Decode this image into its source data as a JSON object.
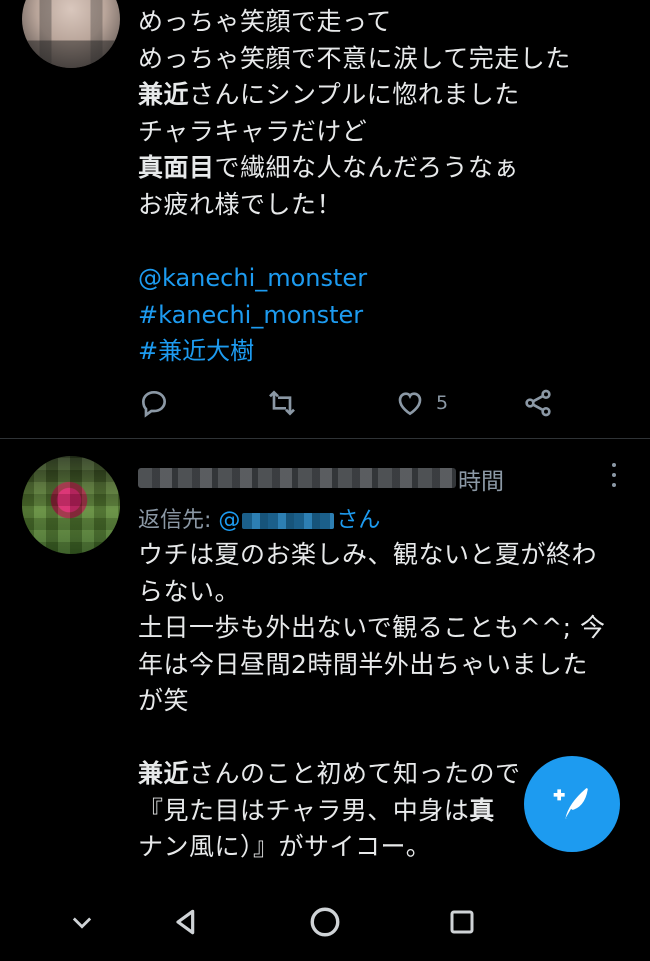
{
  "tweet1": {
    "lines": [
      {
        "text": "めっちゃ笑顔で走って"
      },
      {
        "text": "めっちゃ笑顔で不意に涙して完走した"
      },
      {
        "bold": "兼近",
        "text": "さんにシンプルに惚れました"
      },
      {
        "text": "チャラキャラだけど"
      },
      {
        "bold": "真面目",
        "text": "で繊細な人なんだろうなぁ"
      },
      {
        "text": "お疲れ様でした！"
      }
    ],
    "links": [
      "@kanechi_monster",
      "#kanechi_monster",
      "#兼近大樹"
    ],
    "actions": {
      "reply_icon": "reply-icon",
      "retweet_icon": "retweet-icon",
      "like_icon": "heart-icon",
      "like_count": "5",
      "share_icon": "share-icon"
    }
  },
  "tweet2": {
    "time_suffix": "時間",
    "reply_prefix": "返信先: ",
    "reply_handle_start": "@",
    "reply_suffix": "さん",
    "lines": [
      {
        "text": "ウチは夏のお楽しみ、観ないと夏が終わ"
      },
      {
        "text": "らない。"
      },
      {
        "text": "土日一歩も外出ないで観ることも^^; 今"
      },
      {
        "text": "年は今日昼間2時間半外出ちゃいました"
      },
      {
        "text": "が笑"
      }
    ],
    "lines_after_gap": [
      {
        "bold": "兼近",
        "text": "さんのこと初めて知ったので"
      },
      {
        "text": "『見た目はチャラ男、中身は",
        "bold": "真"
      },
      {
        "text": "ナン風に）』がサイコー。"
      }
    ],
    "more_icon": "more-vertical-icon"
  },
  "fab": {
    "icon": "compose-feather-icon"
  },
  "navbar": {
    "items": [
      "chevron-down-icon",
      "back-triangle-icon",
      "home-circle-icon",
      "recents-square-icon"
    ]
  },
  "colors": {
    "background": "#000000",
    "text": "#e7e9ea",
    "secondary": "#8b98a5",
    "accent": "#1d9bf0",
    "divider": "#2f3336"
  }
}
